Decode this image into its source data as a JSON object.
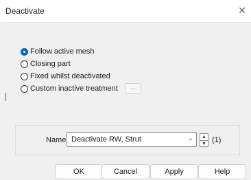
{
  "window": {
    "title": "Deactivate",
    "close_glyph": "✕"
  },
  "options": [
    {
      "label": "Follow active mesh",
      "selected": true
    },
    {
      "label": "Closing part",
      "selected": false
    },
    {
      "label": "Fixed whilst deactivated",
      "selected": false
    },
    {
      "label": "Custom inactive treatment",
      "selected": false
    }
  ],
  "custom_button_label": "...",
  "name_field": {
    "label": "Name",
    "value": "Deactivate RW, Strut",
    "count": "(1)"
  },
  "buttons": {
    "ok": "OK",
    "cancel": "Cancel",
    "apply": "Apply",
    "help": "Help"
  },
  "colors": {
    "accent": "#0067c0"
  }
}
